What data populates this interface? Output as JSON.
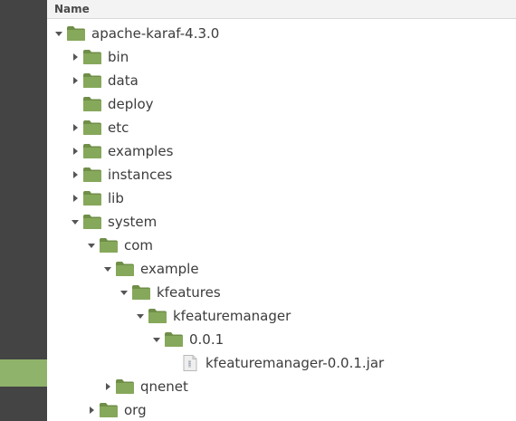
{
  "header": {
    "name_label": "Name"
  },
  "colors": {
    "folder": "#86a85a",
    "folder_dark": "#6f8e47",
    "sidebar_bg": "#444444",
    "sidebar_selected": "#8fb36b"
  },
  "tree": [
    {
      "label": "apache-karaf-4.3.0",
      "expander": "expanded",
      "icon": "folder-icon"
    },
    {
      "label": "bin",
      "expander": "collapsed",
      "icon": "folder-icon"
    },
    {
      "label": "data",
      "expander": "collapsed",
      "icon": "folder-icon"
    },
    {
      "label": "deploy",
      "expander": "none",
      "icon": "folder-icon"
    },
    {
      "label": "etc",
      "expander": "collapsed",
      "icon": "folder-icon"
    },
    {
      "label": "examples",
      "expander": "collapsed",
      "icon": "folder-icon"
    },
    {
      "label": "instances",
      "expander": "collapsed",
      "icon": "folder-icon"
    },
    {
      "label": "lib",
      "expander": "collapsed",
      "icon": "folder-icon"
    },
    {
      "label": "system",
      "expander": "expanded",
      "icon": "folder-icon"
    },
    {
      "label": "com",
      "expander": "expanded",
      "icon": "folder-icon"
    },
    {
      "label": "example",
      "expander": "expanded",
      "icon": "folder-icon"
    },
    {
      "label": "kfeatures",
      "expander": "expanded",
      "icon": "folder-icon"
    },
    {
      "label": "kfeaturemanager",
      "expander": "expanded",
      "icon": "folder-icon"
    },
    {
      "label": "0.0.1",
      "expander": "expanded",
      "icon": "folder-icon"
    },
    {
      "label": "kfeaturemanager-0.0.1.jar",
      "expander": "none",
      "icon": "jar-file-icon"
    },
    {
      "label": "qnenet",
      "expander": "collapsed",
      "icon": "folder-icon"
    },
    {
      "label": "org",
      "expander": "collapsed",
      "icon": "folder-icon"
    }
  ]
}
